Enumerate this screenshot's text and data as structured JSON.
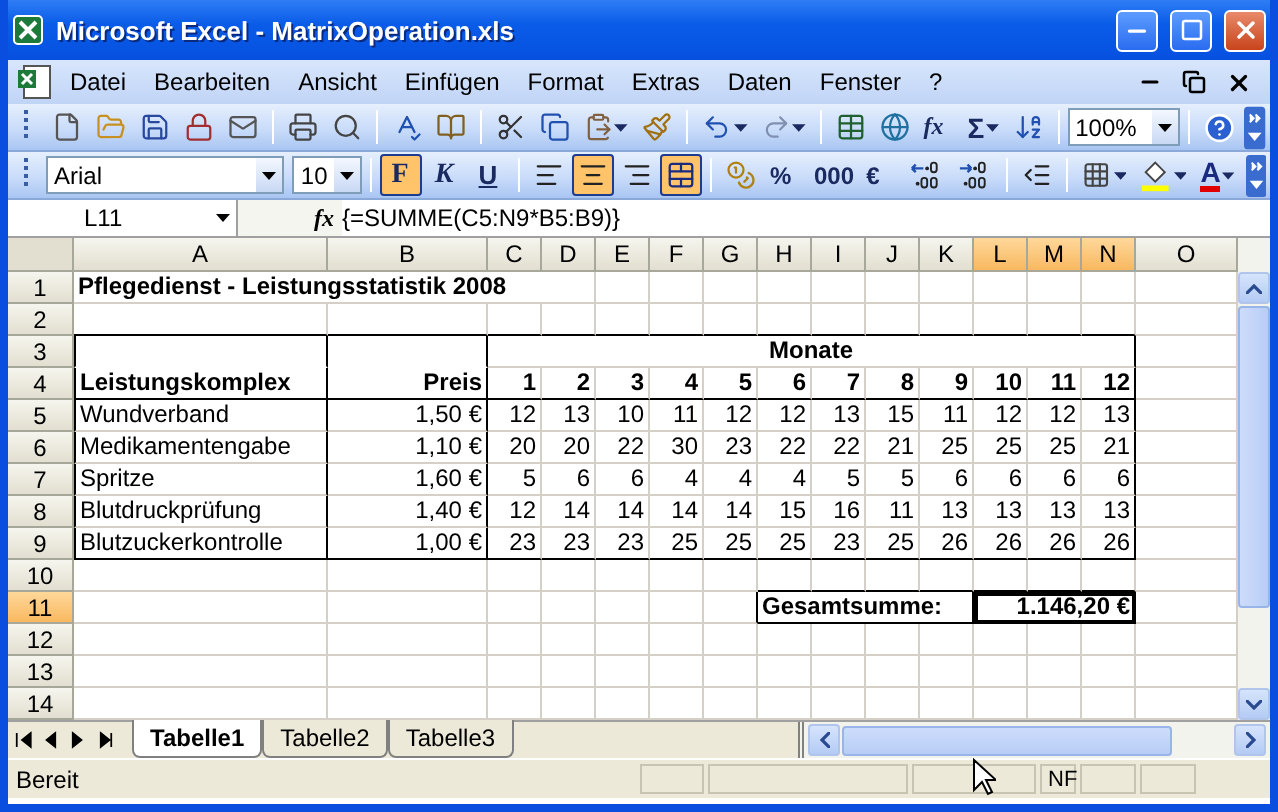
{
  "window": {
    "title": "Microsoft Excel - MatrixOperation.xls"
  },
  "menu": [
    "Datei",
    "Bearbeiten",
    "Ansicht",
    "Einfügen",
    "Format",
    "Extras",
    "Daten",
    "Fenster",
    "?"
  ],
  "standard_toolbar": {
    "buttons": [
      {
        "kind": "new"
      },
      {
        "kind": "open"
      },
      {
        "kind": "save"
      },
      {
        "kind": "permission"
      },
      {
        "kind": "mail"
      },
      {
        "kind": "separator"
      },
      {
        "kind": "print"
      },
      {
        "kind": "preview"
      },
      {
        "kind": "separator"
      },
      {
        "kind": "spelling"
      },
      {
        "kind": "research"
      },
      {
        "kind": "separator"
      },
      {
        "kind": "cut"
      },
      {
        "kind": "copy"
      },
      {
        "kind": "paste",
        "dropdown": true
      },
      {
        "kind": "painter"
      },
      {
        "kind": "separator"
      },
      {
        "kind": "undo",
        "dropdown": true
      },
      {
        "kind": "redo",
        "dropdown": true
      },
      {
        "kind": "separator"
      },
      {
        "kind": "table"
      },
      {
        "kind": "globe"
      },
      {
        "kind": "function",
        "label": "fx"
      },
      {
        "kind": "autosum",
        "label": "Σ",
        "dropdown": true
      },
      {
        "kind": "sort"
      },
      {
        "kind": "separator"
      }
    ],
    "zoom": "100%"
  },
  "formatting_toolbar": {
    "font": "Arial",
    "size": "10",
    "buttons": [
      {
        "kind": "bold",
        "label": "F",
        "selected": true
      },
      {
        "kind": "italic",
        "label": "K",
        "selected": false
      },
      {
        "kind": "underline",
        "label": "U",
        "selected": false
      },
      {
        "kind": "separator"
      },
      {
        "kind": "align-left",
        "selected": false
      },
      {
        "kind": "align-center",
        "selected": true
      },
      {
        "kind": "align-right",
        "selected": false
      },
      {
        "kind": "merge",
        "selected": true
      },
      {
        "kind": "separator"
      },
      {
        "kind": "currency"
      },
      {
        "kind": "text",
        "label": "%"
      },
      {
        "kind": "text",
        "label": "000"
      },
      {
        "kind": "text",
        "label": "€"
      },
      {
        "kind": "more-decimals"
      },
      {
        "kind": "fewer-decimals"
      },
      {
        "kind": "separator"
      },
      {
        "kind": "outdent"
      },
      {
        "kind": "separator"
      },
      {
        "kind": "borders",
        "dropdown": true
      },
      {
        "kind": "fill",
        "dropdown": true
      },
      {
        "kind": "font-color",
        "label": "A",
        "dropdown": true
      }
    ]
  },
  "formula_bar": {
    "name_box": "L11",
    "function_label": "fx",
    "formula": "{=SUMME(C5:N9*B5:B9)}"
  },
  "sheet": {
    "columns": [
      {
        "label": "A",
        "selected": false
      },
      {
        "label": "B",
        "selected": false
      },
      {
        "label": "C",
        "selected": false
      },
      {
        "label": "D",
        "selected": false
      },
      {
        "label": "E",
        "selected": false
      },
      {
        "label": "F",
        "selected": false
      },
      {
        "label": "G",
        "selected": false
      },
      {
        "label": "H",
        "selected": false
      },
      {
        "label": "I",
        "selected": false
      },
      {
        "label": "J",
        "selected": false
      },
      {
        "label": "K",
        "selected": false
      },
      {
        "label": "L",
        "selected": true
      },
      {
        "label": "M",
        "selected": true
      },
      {
        "label": "N",
        "selected": true
      },
      {
        "label": "O",
        "selected": false
      }
    ],
    "rows": [
      {
        "number": "1",
        "selected": false,
        "cells": [
          {
            "text": "Pflegedienst - Leistungsstatistik 2008",
            "bold": true,
            "kind": "label",
            "merged": true
          },
          {},
          {},
          {}
        ]
      },
      {
        "number": "2",
        "selected": false
      },
      {
        "number": "3",
        "selected": false,
        "cells": [
          {},
          {},
          {
            "text": "Monate",
            "bold": true,
            "kind": "heading",
            "merged": true
          },
          {},
          {},
          {},
          {},
          {},
          {},
          {},
          {},
          {},
          {},
          {}
        ]
      },
      {
        "number": "4",
        "selected": false,
        "cells": [
          {
            "text": "Leistungskomplex",
            "bold": true,
            "kind": "label"
          },
          {
            "text": "Preis",
            "bold": true
          },
          {
            "text": "1",
            "bold": true
          },
          {
            "text": "2",
            "bold": true
          },
          {
            "text": "3",
            "bold": true
          },
          {
            "text": "4",
            "bold": true
          },
          {
            "text": "5",
            "bold": true
          },
          {
            "text": "6",
            "bold": true
          },
          {
            "text": "7",
            "bold": true
          },
          {
            "text": "8",
            "bold": true
          },
          {
            "text": "9",
            "bold": true
          },
          {
            "text": "10",
            "bold": true
          },
          {
            "text": "11",
            "bold": true
          },
          {
            "text": "12",
            "bold": true
          }
        ]
      },
      {
        "number": "5",
        "selected": false,
        "cells": [
          {
            "text": "Wundverband",
            "kind": "label"
          },
          {
            "text": "1,50 €"
          },
          {
            "text": "12"
          },
          {
            "text": "13"
          },
          {
            "text": "10"
          },
          {
            "text": "11"
          },
          {
            "text": "12"
          },
          {
            "text": "12"
          },
          {
            "text": "13"
          },
          {
            "text": "15"
          },
          {
            "text": "11"
          },
          {
            "text": "12"
          },
          {
            "text": "12"
          },
          {
            "text": "13"
          }
        ]
      },
      {
        "number": "6",
        "selected": false,
        "cells": [
          {
            "text": "Medikamentengabe",
            "kind": "label"
          },
          {
            "text": "1,10 €"
          },
          {
            "text": "20"
          },
          {
            "text": "20"
          },
          {
            "text": "22"
          },
          {
            "text": "30"
          },
          {
            "text": "23"
          },
          {
            "text": "22"
          },
          {
            "text": "22"
          },
          {
            "text": "21"
          },
          {
            "text": "25"
          },
          {
            "text": "25"
          },
          {
            "text": "25"
          },
          {
            "text": "21"
          }
        ]
      },
      {
        "number": "7",
        "selected": false,
        "cells": [
          {
            "text": "Spritze",
            "kind": "label"
          },
          {
            "text": "1,60 €"
          },
          {
            "text": "5"
          },
          {
            "text": "6"
          },
          {
            "text": "6"
          },
          {
            "text": "4"
          },
          {
            "text": "4"
          },
          {
            "text": "4"
          },
          {
            "text": "5"
          },
          {
            "text": "5"
          },
          {
            "text": "6"
          },
          {
            "text": "6"
          },
          {
            "text": "6"
          },
          {
            "text": "6"
          }
        ]
      },
      {
        "number": "8",
        "selected": false,
        "cells": [
          {
            "text": "Blutdruckprüfung",
            "kind": "label"
          },
          {
            "text": "1,40 €"
          },
          {
            "text": "12"
          },
          {
            "text": "14"
          },
          {
            "text": "14"
          },
          {
            "text": "14"
          },
          {
            "text": "14"
          },
          {
            "text": "15"
          },
          {
            "text": "16"
          },
          {
            "text": "11"
          },
          {
            "text": "13"
          },
          {
            "text": "13"
          },
          {
            "text": "13"
          },
          {
            "text": "13"
          }
        ]
      },
      {
        "number": "9",
        "selected": false,
        "cells": [
          {
            "text": "Blutzuckerkontrolle",
            "kind": "label"
          },
          {
            "text": "1,00 €"
          },
          {
            "text": "23"
          },
          {
            "text": "23"
          },
          {
            "text": "23"
          },
          {
            "text": "25"
          },
          {
            "text": "25"
          },
          {
            "text": "25"
          },
          {
            "text": "23"
          },
          {
            "text": "25"
          },
          {
            "text": "26"
          },
          {
            "text": "26"
          },
          {
            "text": "26"
          },
          {
            "text": "26"
          }
        ]
      },
      {
        "number": "10",
        "selected": false
      },
      {
        "number": "11",
        "selected": true,
        "cells": [
          {},
          {},
          {},
          {},
          {},
          {},
          {},
          {
            "text": "Gesamtsumme:",
            "bold": true,
            "kind": "label",
            "merged": true
          },
          {},
          {},
          {},
          {
            "text": "1.146,20 €",
            "bold": true,
            "merged": true
          },
          {},
          {}
        ]
      },
      {
        "number": "12",
        "selected": false
      },
      {
        "number": "13",
        "selected": false
      },
      {
        "number": "14",
        "selected": false
      }
    ]
  },
  "sheet_tabs": [
    {
      "label": "Tabelle1",
      "selected": true
    },
    {
      "label": "Tabelle2",
      "selected": false
    },
    {
      "label": "Tabelle3",
      "selected": false
    }
  ],
  "status_bar": {
    "status": "Bereit",
    "indicator": "NF"
  }
}
